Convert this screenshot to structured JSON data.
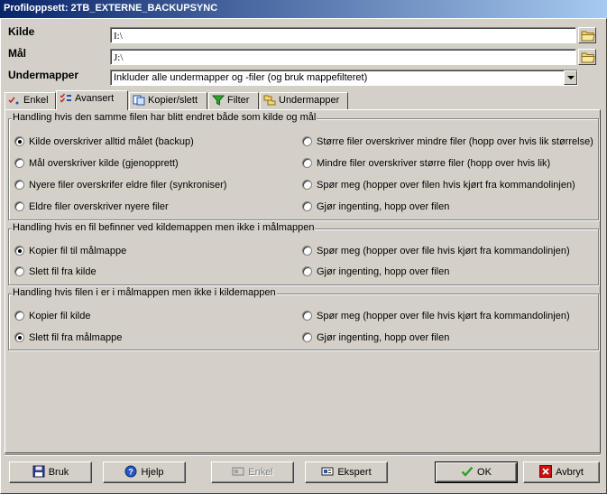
{
  "window": {
    "title": "Profiloppsett: 2TB_EXTERNE_BACKUPSYNC"
  },
  "form": {
    "source_label": "Kilde",
    "source_value": "I:\\",
    "target_label": "Mål",
    "target_value": "J:\\",
    "subfolders_label": "Undermapper",
    "subfolders_value": "Inkluder alle undermapper og -filer (og bruk mappefilteret)"
  },
  "tabs": [
    {
      "label": "Enkel"
    },
    {
      "label": "Avansert"
    },
    {
      "label": "Kopier/slett"
    },
    {
      "label": "Filter"
    },
    {
      "label": "Undermapper"
    }
  ],
  "groups": {
    "both_changed": {
      "title": "Handling hvis den samme filen har blitt endret både som kilde og mål",
      "options": [
        {
          "label": "Kilde overskriver alltid målet (backup)",
          "checked": true
        },
        {
          "label": "Mål overskriver kilde (gjenopprett)",
          "checked": false
        },
        {
          "label": "Nyere filer overskrifer eldre filer (synkroniser)",
          "checked": false
        },
        {
          "label": "Eldre filer overskriver nyere filer",
          "checked": false
        },
        {
          "label": "Større filer overskriver mindre filer (hopp over hvis lik størrelse)",
          "checked": false
        },
        {
          "label": "Mindre filer overskriver større filer (hopp over hvis lik)",
          "checked": false
        },
        {
          "label": "Spør meg (hopper over filen hvis kjørt fra kommandolinjen)",
          "checked": false
        },
        {
          "label": "Gjør ingenting, hopp over filen",
          "checked": false
        }
      ]
    },
    "only_source": {
      "title": "Handling hvis en fil befinner ved kildemappen men ikke i målmappen",
      "options": [
        {
          "label": "Kopier fil til målmappe",
          "checked": true
        },
        {
          "label": "Slett fil fra kilde",
          "checked": false
        },
        {
          "label": "Spør meg (hopper over file hvis kjørt fra kommandolinjen)",
          "checked": false
        },
        {
          "label": "Gjør ingenting, hopp over filen",
          "checked": false
        }
      ]
    },
    "only_target": {
      "title": "Handling hvis filen i er i målmappen men ikke i kildemappen",
      "options": [
        {
          "label": "Kopier fil kilde",
          "checked": false
        },
        {
          "label": "Slett fil fra målmappe",
          "checked": true
        },
        {
          "label": "Spør meg (hopper over file hvis kjørt fra kommandolinjen)",
          "checked": false
        },
        {
          "label": "Gjør ingenting, hopp over filen",
          "checked": false
        }
      ]
    }
  },
  "buttons": {
    "use": "Bruk",
    "help": "Hjelp",
    "simple": "Enkel",
    "expert": "Ekspert",
    "ok": "OK",
    "cancel": "Avbryt"
  },
  "colors": {
    "title_start": "#0a246a",
    "title_end": "#a6caf0",
    "face": "#d4d0c8",
    "ok_check": "#2e9e2e",
    "cancel_x": "#cc1010"
  }
}
